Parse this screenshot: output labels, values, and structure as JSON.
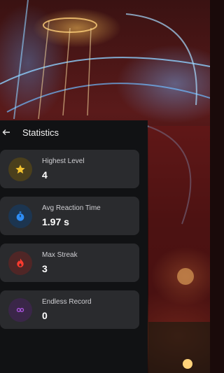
{
  "header": {
    "title": "Statistics",
    "back_icon": "arrow-left-icon"
  },
  "stats": [
    {
      "label": "Highest Level",
      "value": "4",
      "icon": "star-icon",
      "icon_color": "#f2c230",
      "icon_bg": "#4a3f1c"
    },
    {
      "label": "Avg Reaction Time",
      "value": "1.97 s",
      "icon": "stopwatch-icon",
      "icon_color": "#2e8df5",
      "icon_bg": "#1c3550"
    },
    {
      "label": "Max Streak",
      "value": "3",
      "icon": "fire-icon",
      "icon_color": "#ff3b2f",
      "icon_bg": "#4f2626"
    },
    {
      "label": "Endless Record",
      "value": "0",
      "icon": "infinity-icon",
      "icon_color": "#b056e6",
      "icon_bg": "#3a2648"
    }
  ]
}
